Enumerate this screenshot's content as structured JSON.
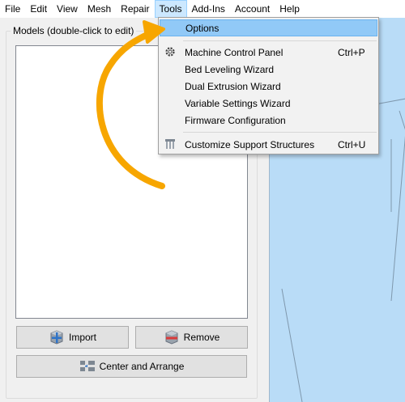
{
  "menubar": {
    "items": [
      "File",
      "Edit",
      "View",
      "Mesh",
      "Repair",
      "Tools",
      "Add-Ins",
      "Account",
      "Help"
    ],
    "active_item": "Tools"
  },
  "models_panel": {
    "title": "Models (double-click to edit)",
    "buttons": {
      "import": "Import",
      "remove": "Remove",
      "center_arrange": "Center and Arrange"
    }
  },
  "tools_menu": {
    "items": [
      {
        "label": "Options",
        "shortcut": "",
        "icon": "",
        "highlighted": true
      },
      {
        "label": "Machine Control Panel",
        "shortcut": "Ctrl+P",
        "icon": "gear-icon"
      },
      {
        "label": "Bed Leveling Wizard",
        "shortcut": ""
      },
      {
        "label": "Dual Extrusion Wizard",
        "shortcut": ""
      },
      {
        "label": "Variable Settings Wizard",
        "shortcut": ""
      },
      {
        "label": "Firmware Configuration",
        "shortcut": ""
      },
      {
        "label": "Customize Support Structures",
        "shortcut": "Ctrl+U",
        "icon": "support-structures-icon"
      }
    ]
  },
  "colors": {
    "menu_highlight": "#91c9f7",
    "annotation_arrow": "#f7a600",
    "viewport_bg": "#b9dcf7"
  }
}
